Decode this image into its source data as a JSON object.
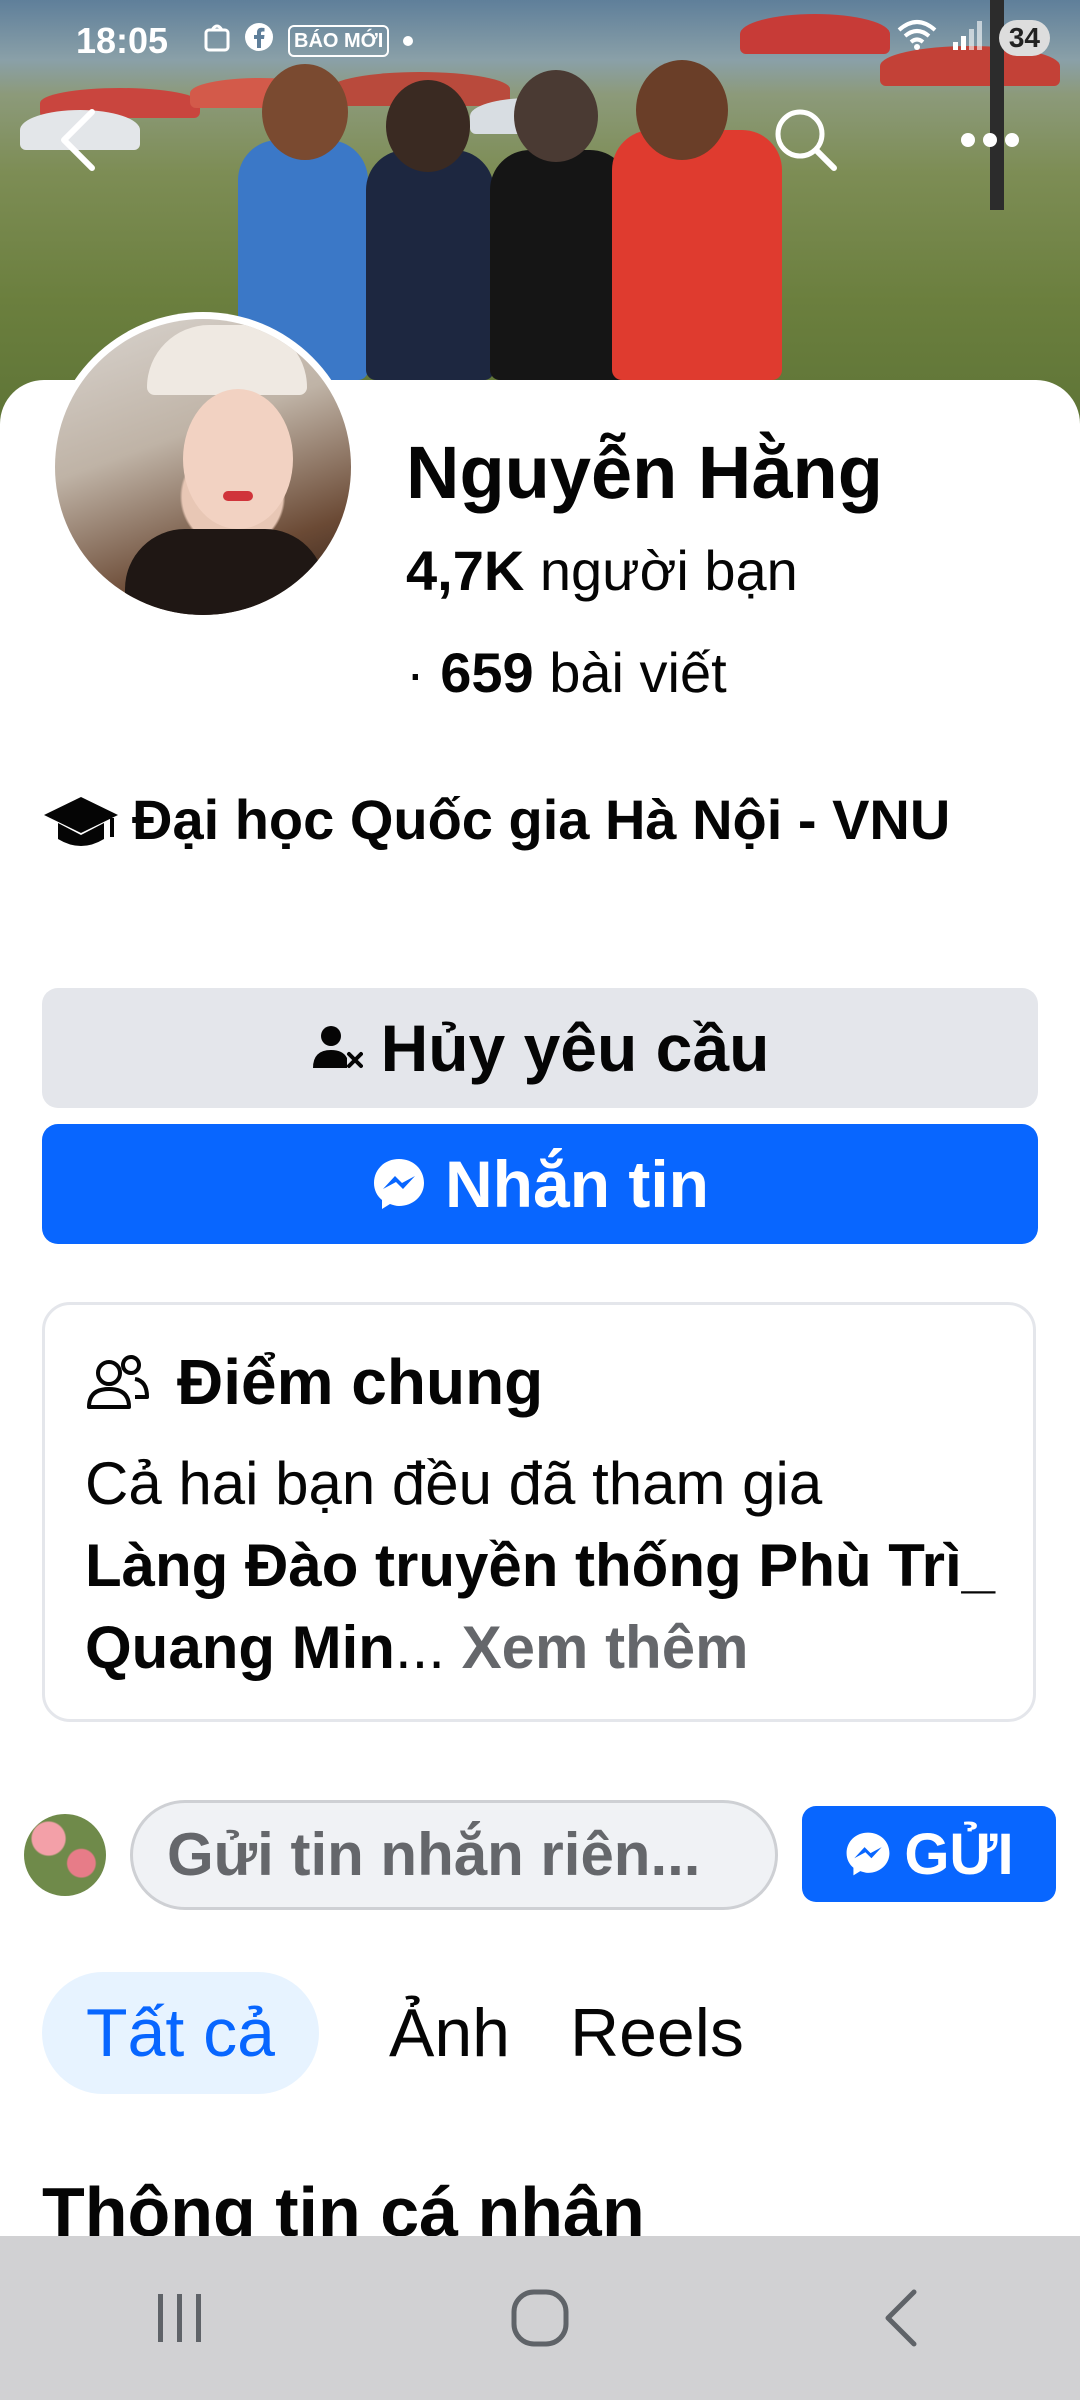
{
  "status_bar": {
    "time": "18:05",
    "notification_app": "BÁO MỚI",
    "battery": "34"
  },
  "profile": {
    "name": "Nguyễn Hằng",
    "friends_count": "4,7K",
    "friends_label": "người bạn",
    "posts_prefix": "·",
    "posts_count": "659",
    "posts_label": "bài viết",
    "education": "Đại học Quốc gia Hà Nội - VNU"
  },
  "actions": {
    "cancel_request": "Hủy yêu cầu",
    "message": "Nhắn tin"
  },
  "mutual": {
    "title": "Điểm chung",
    "text": "Cả hai bạn đều đã tham gia",
    "group": "Làng Đào truyền thống Phù Trì_ Quang Min",
    "ellipsis": "...",
    "see_more": "Xem thêm"
  },
  "composer": {
    "placeholder": "Gửi tin nhắn riên...",
    "send": "GỬI"
  },
  "tabs": [
    {
      "label": "Tất cả",
      "active": true
    },
    {
      "label": "Ảnh",
      "active": false
    },
    {
      "label": "Reels",
      "active": false
    }
  ],
  "section_title": "Thông tin cá nhân",
  "colors": {
    "accent": "#0866ff",
    "secondary_button": "#e4e6eb",
    "tab_active_bg": "#e7f3ff",
    "nav_bar": "#d1d1d3"
  },
  "icons": [
    "back-icon",
    "search-icon",
    "more-icon",
    "graduation-cap-icon",
    "cancel-request-icon",
    "messenger-icon",
    "mutual-friends-icon",
    "recents-icon",
    "home-icon",
    "nav-back-icon"
  ]
}
